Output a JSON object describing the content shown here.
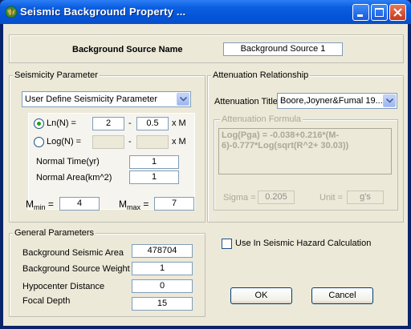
{
  "window": {
    "title": "Seismic Background Property ..."
  },
  "source": {
    "label": "Background Source Name",
    "value": "Background Source 1"
  },
  "seismicity": {
    "group_title": "Seismicity Parameter",
    "mode_selected": "User Define Seismicity Parameter",
    "ln_label": "Ln(N) =",
    "ln_a": "2",
    "ln_dash": "-",
    "ln_b": "0.5",
    "ln_xm": "x M",
    "log_label": "Log(N) =",
    "log_dash": "-",
    "log_xm": "x M",
    "normal_time_label": "Normal Time(yr)",
    "normal_time_value": "1",
    "normal_area_label": "Normal Area(km^2)",
    "normal_area_value": "1",
    "mmin_m": "M",
    "mmin_sub": "min",
    "mmin_eq": "=",
    "mmin_value": "4",
    "mmax_m": "M",
    "mmax_sub": "max",
    "mmax_eq": "=",
    "mmax_value": "7"
  },
  "attenuation": {
    "group_title": "Attenuation Relationship",
    "title_label": "Attenuation Title",
    "title_selected": "Boore,Joyner&Fumal 19...",
    "formula_group_title": "Attenuation Formula",
    "formula_text": "Log(Pga) = -0.038+0.216*(M-6)-0.777*Log(sqrt(R^2+ 30.03))",
    "sigma_label": "Sigma =",
    "sigma_value": "0.205",
    "unit_label": "Unit =",
    "unit_value": "g's"
  },
  "general": {
    "group_title": "General Parameters",
    "area_label": "Background Seismic Area",
    "area_value": "478704",
    "weight_label": "Background Source Weight",
    "weight_value": "1",
    "hypo_label": "Hypocenter Distance",
    "hypo_value": "0",
    "focal_label": "Focal Depth",
    "focal_value": "15"
  },
  "hazard": {
    "label": "Use In Seismic Hazard Calculation",
    "checked": false
  },
  "buttons": {
    "ok": "OK",
    "cancel": "Cancel"
  },
  "colors": {
    "titlebar": "#0454d8",
    "face": "#ece9d8",
    "radio_dot": "#21a121"
  }
}
